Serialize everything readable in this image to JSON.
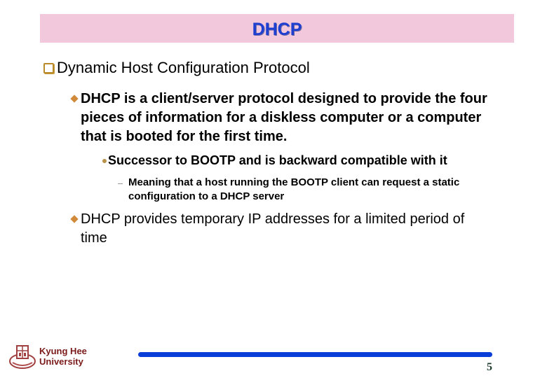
{
  "slide": {
    "title": "DHCP",
    "heading": "Dynamic Host Configuration Protocol",
    "bullets": [
      {
        "text": "DHCP is a client/server protocol designed to provide the four pieces of information for a diskless computer or a computer that is booted for the first time.",
        "sub": {
          "text": "Successor to BOOTP and is backward compatible with it",
          "sub": "Meaning that a host running the BOOTP client can request a static configuration to a DHCP server"
        }
      },
      {
        "text": "DHCP provides  temporary IP addresses for a limited period of time"
      }
    ]
  },
  "footer": {
    "university_line1": "Kyung Hee",
    "university_line2": "University",
    "page_number": "5",
    "logo_icon": "university-crest-icon",
    "accent_color": "#0a3ed8"
  },
  "colors": {
    "title_bg": "#f2c8dc",
    "title_text": "#1f3fd0",
    "bullet_accent": "#d08a3a",
    "university_text": "#7a1a1a"
  }
}
